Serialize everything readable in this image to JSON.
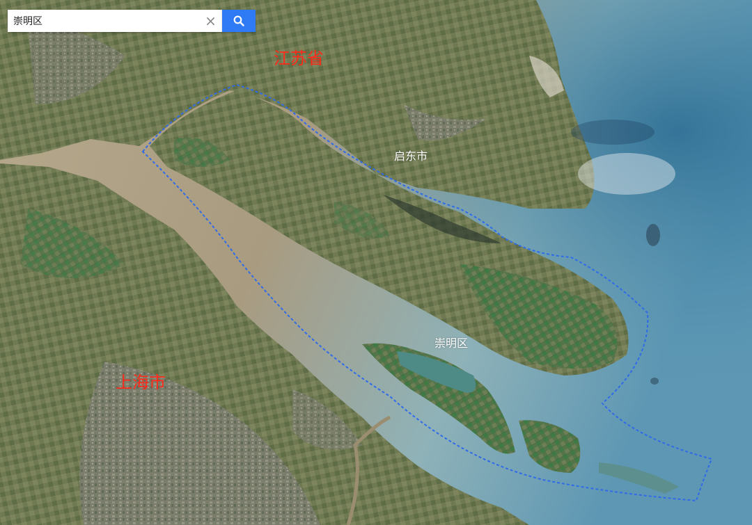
{
  "search": {
    "value": "崇明区",
    "clear_glyph": "×",
    "clear_icon": "close-icon",
    "button_icon": "search-icon",
    "button_color": "#2f7bf5"
  },
  "map": {
    "type": "satellite",
    "boundary_color": "#2f6ae8",
    "labels": {
      "jiangsu": "江苏省",
      "qidong": "启东市",
      "chongming": "崇明区",
      "shanghai": "上海市"
    },
    "province_label_color": "#ff2a1a",
    "county_label_color": "#ffffff"
  }
}
